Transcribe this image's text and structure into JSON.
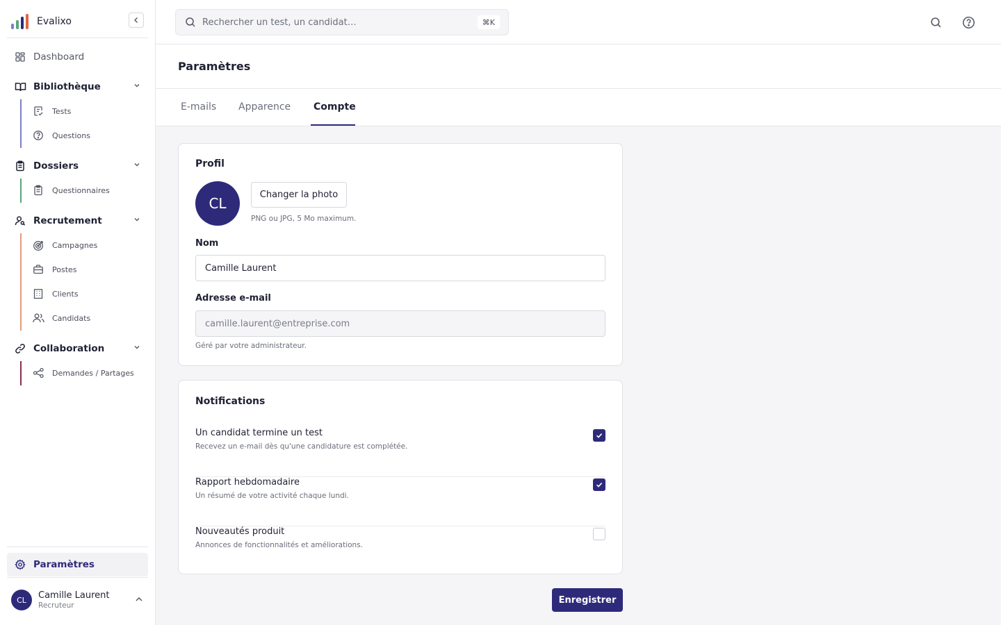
{
  "app": {
    "name": "Evalixo"
  },
  "colors": {
    "accent": "#2e2a7a",
    "bibliotheque": "#7b7ec8",
    "dossiers": "#5aa47a",
    "recrutement": "#e49a7a",
    "collaboration": "#8a2e4a"
  },
  "sidebar": {
    "dashboard": "Dashboard",
    "groups": [
      {
        "label": "Bibliothèque",
        "icon": "book-icon",
        "items": [
          {
            "label": "Tests",
            "icon": "test-icon"
          },
          {
            "label": "Questions",
            "icon": "question-circle-icon"
          }
        ]
      },
      {
        "label": "Dossiers",
        "icon": "clipboard-icon",
        "items": [
          {
            "label": "Questionnaires",
            "icon": "clipboard-icon"
          }
        ]
      },
      {
        "label": "Recrutement",
        "icon": "user-search-icon",
        "items": [
          {
            "label": "Campagnes",
            "icon": "target-icon"
          },
          {
            "label": "Postes",
            "icon": "briefcase-icon"
          },
          {
            "label": "Clients",
            "icon": "building-icon"
          },
          {
            "label": "Candidats",
            "icon": "users-icon"
          }
        ]
      },
      {
        "label": "Collaboration",
        "icon": "link-icon",
        "items": [
          {
            "label": "Demandes / Partages",
            "icon": "share-icon"
          }
        ]
      }
    ],
    "settings": "Paramètres",
    "user": {
      "initials": "CL",
      "name": "Camille Laurent",
      "role": "Recruteur"
    }
  },
  "topbar": {
    "search_placeholder": "Rechercher un test, un candidat…",
    "shortcut": "⌘K"
  },
  "page": {
    "title": "Paramètres",
    "tabs": [
      "E-mails",
      "Apparence",
      "Compte"
    ],
    "active_tab": "Compte"
  },
  "profile": {
    "title": "Profil",
    "initials": "CL",
    "change_photo": "Changer la photo",
    "photo_hint": "PNG ou JPG, 5 Mo maximum.",
    "name_label": "Nom",
    "name_value": "Camille Laurent",
    "email_label": "Adresse e-mail",
    "email_value": "camille.laurent@entreprise.com",
    "email_hint": "Géré par votre administrateur."
  },
  "notifications": {
    "title": "Notifications",
    "items": [
      {
        "title": "Un candidat termine un test",
        "desc": "Recevez un e-mail dès qu'une candidature est complétée.",
        "checked": true
      },
      {
        "title": "Rapport hebdomadaire",
        "desc": "Un résumé de votre activité chaque lundi.",
        "checked": true
      },
      {
        "title": "Nouveautés produit",
        "desc": "Annonces de fonctionnalités et améliorations.",
        "checked": false
      }
    ]
  },
  "actions": {
    "save": "Enregistrer"
  }
}
